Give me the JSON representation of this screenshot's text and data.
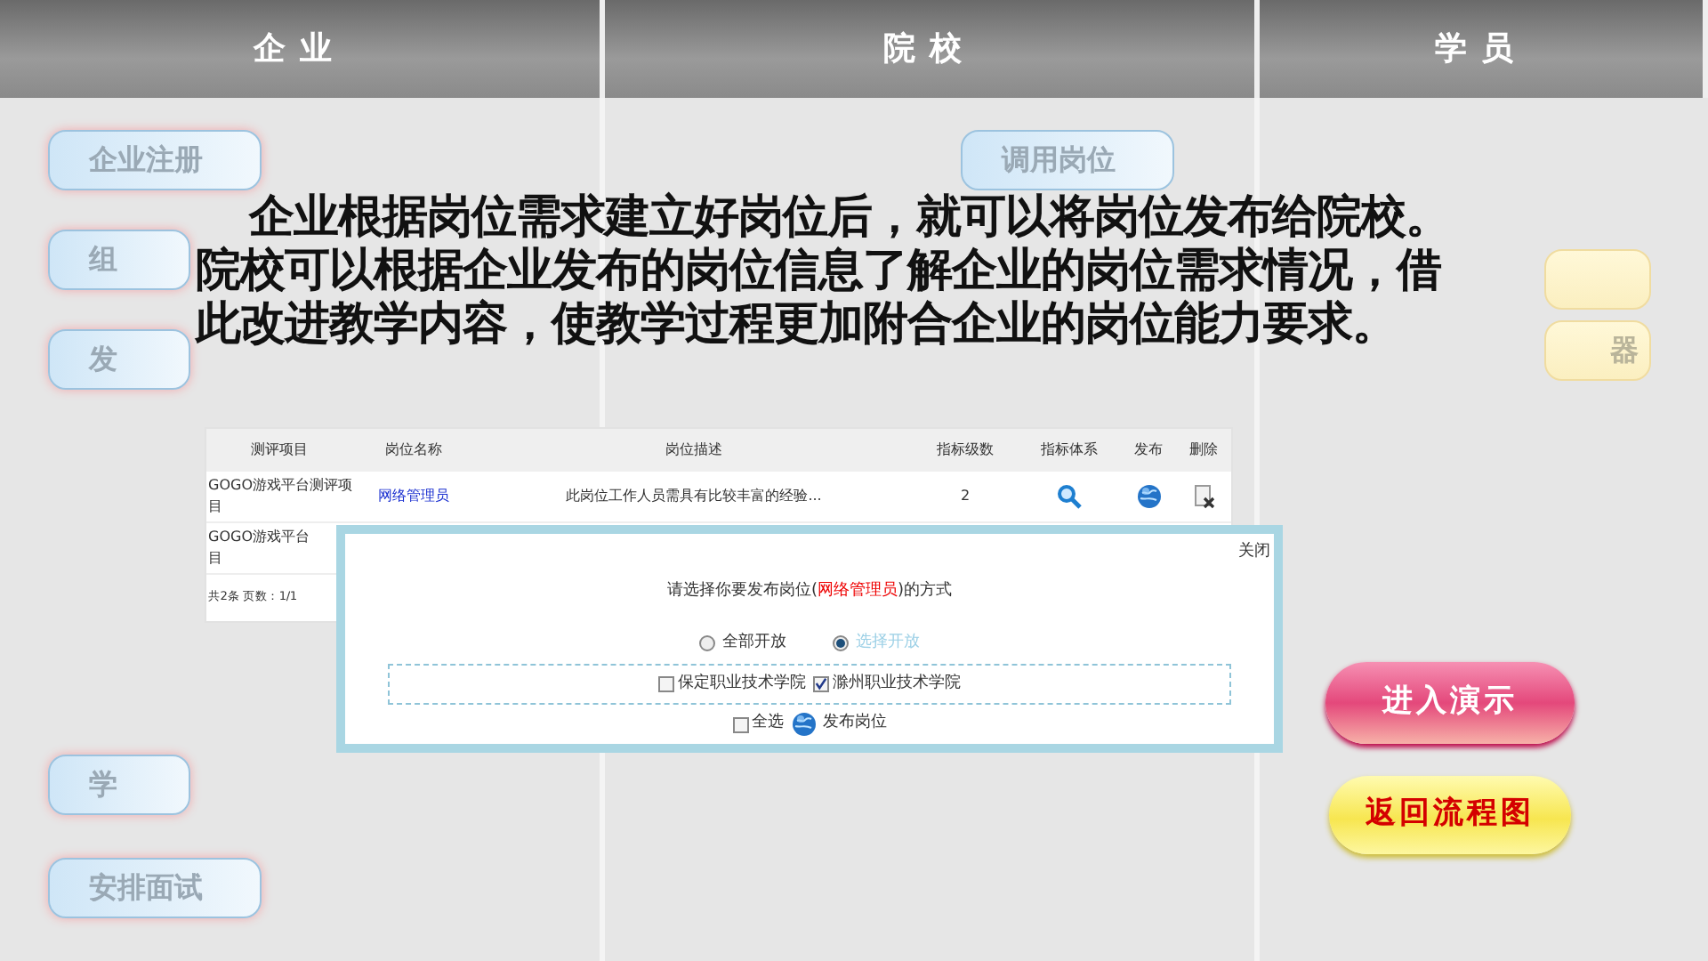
{
  "header": {
    "columns": [
      {
        "label": "企业"
      },
      {
        "label": "院校"
      },
      {
        "label": "学员"
      }
    ]
  },
  "background": {
    "left_top": [
      {
        "label": "企业注册",
        "kind": "whole"
      },
      {
        "label": "组",
        "kind": "cut"
      },
      {
        "label": "发",
        "kind": "cut"
      }
    ],
    "left_bottom": [
      {
        "label": "学",
        "kind": "cut"
      },
      {
        "label": "安排面试",
        "kind": "whole"
      }
    ],
    "middle": [
      {
        "label": "调用岗位"
      }
    ],
    "right": [
      {
        "kind": "blank"
      },
      {
        "kind": "labeled",
        "label": "器"
      }
    ]
  },
  "description": [
    "企业根据岗位需求建立好岗位后，就可以将岗位发布给院校。",
    "院校可以根据企业发布的岗位信息了解企业的岗位需求情况，借此改进教学内容，使教学过程更加附合企业的岗位能力要求。"
  ],
  "table": {
    "columns": [
      "测评项目",
      "岗位名称",
      "岗位描述",
      "指标级数",
      "指标体系",
      "发布",
      "删除"
    ],
    "rows": [
      {
        "project": [
          "GOGO游戏平台测评项",
          "目"
        ],
        "position": "网络管理员",
        "description": "此岗位工作人员需具有比较丰富的经验...",
        "levels": "2"
      },
      {
        "project": [
          "GOGO游戏平台",
          "目"
        ]
      }
    ],
    "footer": "共2条 页数：1/1"
  },
  "dialog": {
    "close": "关闭",
    "prompt_before": "请选择你要发布岗位(",
    "prompt_position": "网络管理员",
    "prompt_after": ")的方式",
    "modes": [
      {
        "label": "全部开放",
        "selected": false
      },
      {
        "label": "选择开放",
        "selected": true
      }
    ],
    "schools": [
      {
        "label": "保定职业技术学院",
        "checked": false
      },
      {
        "label": "滁州职业技术学院",
        "checked": true
      }
    ],
    "select_all": {
      "label": "全选",
      "checked": false
    },
    "publish": "发布岗位"
  },
  "actions": [
    {
      "label": "进入演示",
      "kind": "pink"
    },
    {
      "label": "返回流程图",
      "kind": "yellow"
    }
  ]
}
